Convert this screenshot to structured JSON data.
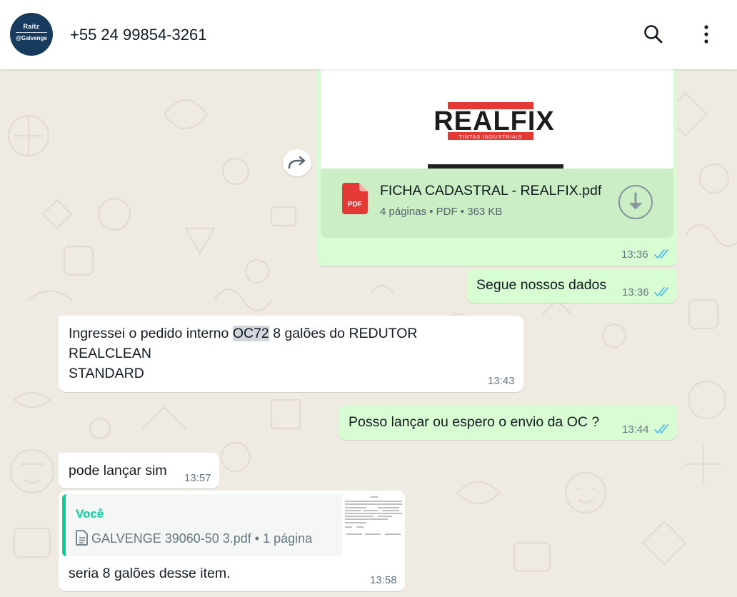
{
  "header": {
    "contact_name": "+55 24 99854-3261",
    "avatar_text_1": "Raitz",
    "avatar_text_2": "@Galvenge",
    "search_icon": "search-icon",
    "menu_icon": "kebab-menu-icon"
  },
  "messages": [
    {
      "direction": "outgoing",
      "type": "document",
      "preview_brand": "REALFIX",
      "preview_tagline": "TINTAS INDUSTRIAIS",
      "file_name": "FICHA CADASTRAL - REALFIX.pdf",
      "file_badge": "PDF",
      "file_meta": "4 páginas • PDF • 363 KB",
      "time": "13:36",
      "status": "read"
    },
    {
      "direction": "outgoing",
      "type": "text",
      "text": "Segue nossos dados",
      "time": "13:36",
      "status": "read"
    },
    {
      "direction": "incoming",
      "type": "text",
      "text_before_highlight": "Ingressei o pedido interno ",
      "highlight": "OC72",
      "text_after_highlight": " 8 galões do REDUTOR",
      "line2": "REALCLEAN",
      "line3": "STANDARD",
      "time": "13:43"
    },
    {
      "direction": "outgoing",
      "type": "text",
      "text": "Posso lançar ou espero o envio da OC ?",
      "time": "13:44",
      "status": "read"
    },
    {
      "direction": "incoming",
      "type": "text",
      "text": "pode lançar sim",
      "time": "13:57"
    },
    {
      "direction": "incoming",
      "type": "reply",
      "quote_author": "Você",
      "quote_doc": "GALVENGE 39060-50 3.pdf • 1 página",
      "text": "seria 8 galões desse item.",
      "time": "13:58"
    }
  ],
  "colors": {
    "outgoing_bubble": "#d9fdd3",
    "incoming_bubble": "#ffffff",
    "read_ticks": "#53bdeb",
    "quote_accent": "#06cf9c",
    "pdf_red": "#e53935"
  }
}
